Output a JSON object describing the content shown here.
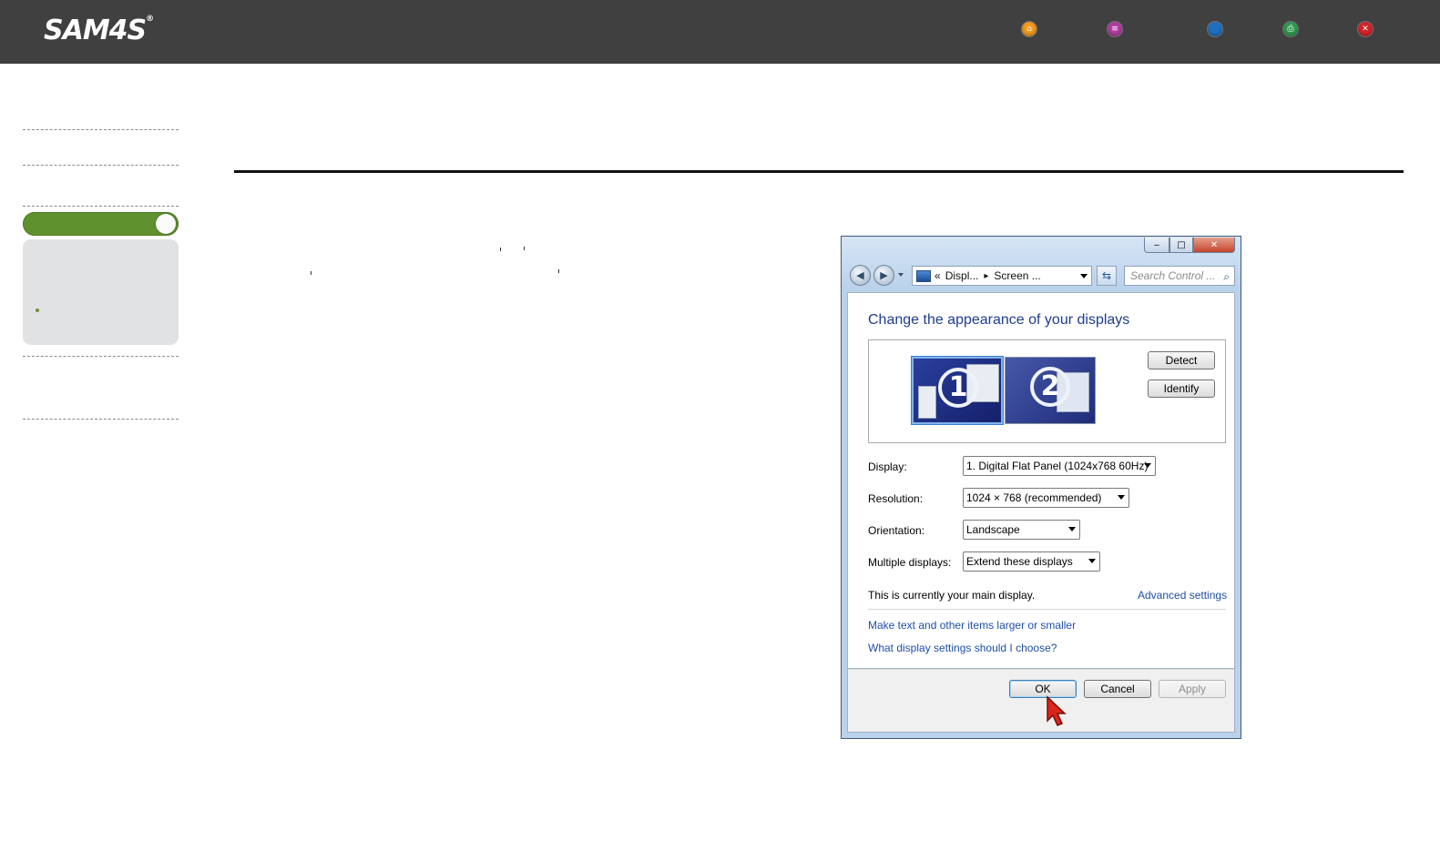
{
  "brand": {
    "logo": "SAM4S",
    "mark": "®"
  },
  "topnav": [
    {
      "name": "home",
      "icon": "home-icon",
      "color": "#f39a1d",
      "glyph": "⌂"
    },
    {
      "name": "contents",
      "icon": "list-icon",
      "color": "#b23da0",
      "glyph": "≡"
    },
    {
      "name": "back",
      "icon": "back-icon",
      "color": "#1f6fc0",
      "glyph": ""
    },
    {
      "name": "print",
      "icon": "print-icon",
      "color": "#2f9a4e",
      "glyph": "⎙"
    },
    {
      "name": "close",
      "icon": "close-icon",
      "color": "#d2232a",
      "glyph": "✕"
    }
  ],
  "sidebar": {
    "accent": "#5f922e"
  },
  "dialog": {
    "window_controls": {
      "minimize": "‒",
      "maximize": "□",
      "close": "✕"
    },
    "address": {
      "chevrons": "«",
      "segment1": "Displ...",
      "separator": "▸",
      "segment2": "Screen ..."
    },
    "search_placeholder": "Search Control ...",
    "heading": "Change the appearance of your displays",
    "monitors": [
      "1",
      "2"
    ],
    "buttons": {
      "detect": "Detect",
      "identify": "Identify"
    },
    "fields": [
      {
        "label": "Display:",
        "value": "1. Digital Flat Panel (1024x768 60Hz)"
      },
      {
        "label": "Resolution:",
        "value": "1024 × 768 (recommended)"
      },
      {
        "label": "Orientation:",
        "value": "Landscape"
      },
      {
        "label": "Multiple displays:",
        "value": "Extend these displays"
      }
    ],
    "status": "This is currently your main display.",
    "advanced_link": "Advanced settings",
    "links": [
      "Make text and other items larger or smaller",
      "What display settings should I choose?"
    ],
    "footer": {
      "ok": "OK",
      "cancel": "Cancel",
      "apply": "Apply"
    }
  }
}
